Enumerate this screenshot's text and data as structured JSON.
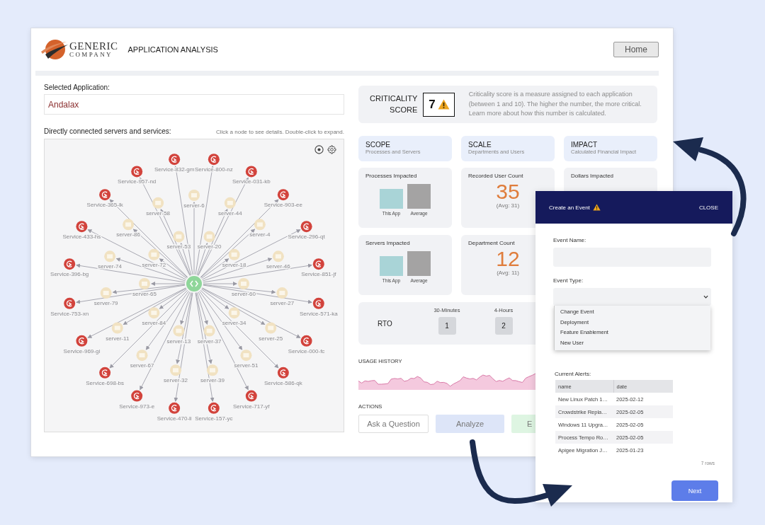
{
  "header": {
    "logo_line_1": "GENERIC",
    "logo_line_2": "COMPANY",
    "title": "APPLICATION ANALYSIS",
    "home_button": "Home"
  },
  "app_selector": {
    "label": "Selected Application:",
    "value": "Andalax"
  },
  "graph": {
    "title": "Directly connected servers and services:",
    "hint": "Click a node to see details. Double-click to expand.",
    "nodes": [
      {
        "label": "Service-832-gm",
        "kind": "service"
      },
      {
        "label": "Service-800-nz",
        "kind": "service"
      },
      {
        "label": "Service-957-nd",
        "kind": "service"
      },
      {
        "label": "Service-031-kb",
        "kind": "service"
      },
      {
        "label": "Service-365-lk",
        "kind": "service"
      },
      {
        "label": "server-6",
        "kind": "server"
      },
      {
        "label": "Service-903-ee",
        "kind": "service"
      },
      {
        "label": "server-58",
        "kind": "server"
      },
      {
        "label": "server-44",
        "kind": "server"
      },
      {
        "label": "Service-433-hs",
        "kind": "service"
      },
      {
        "label": "server-86",
        "kind": "server"
      },
      {
        "label": "server-4",
        "kind": "server"
      },
      {
        "label": "Service-296-qt",
        "kind": "service"
      },
      {
        "label": "server-53",
        "kind": "server"
      },
      {
        "label": "server-20",
        "kind": "server"
      },
      {
        "label": "server-74",
        "kind": "server"
      },
      {
        "label": "server-72",
        "kind": "server"
      },
      {
        "label": "server-18",
        "kind": "server"
      },
      {
        "label": "server-46",
        "kind": "server"
      },
      {
        "label": "Service-396-bg",
        "kind": "service"
      },
      {
        "label": "Service-851-jf",
        "kind": "service"
      },
      {
        "label": "server-65",
        "kind": "server"
      },
      {
        "label": "server-60",
        "kind": "server"
      },
      {
        "label": "server-79",
        "kind": "server"
      },
      {
        "label": "server-27",
        "kind": "server"
      },
      {
        "label": "Service-753-xn",
        "kind": "service"
      },
      {
        "label": "Service-571-ka",
        "kind": "service"
      },
      {
        "label": "server-84",
        "kind": "server"
      },
      {
        "label": "server-34",
        "kind": "server"
      },
      {
        "label": "server-11",
        "kind": "server"
      },
      {
        "label": "server-13",
        "kind": "server"
      },
      {
        "label": "server-37",
        "kind": "server"
      },
      {
        "label": "server-25",
        "kind": "server"
      },
      {
        "label": "Service-969-gi",
        "kind": "service"
      },
      {
        "label": "Service-000-fc",
        "kind": "service"
      },
      {
        "label": "server-67",
        "kind": "server"
      },
      {
        "label": "server-51",
        "kind": "server"
      },
      {
        "label": "Service-698-bs",
        "kind": "service"
      },
      {
        "label": "server-32",
        "kind": "server"
      },
      {
        "label": "server-39",
        "kind": "server"
      },
      {
        "label": "Service-586-qk",
        "kind": "service"
      },
      {
        "label": "Service-973-e",
        "kind": "service"
      },
      {
        "label": "Service-717-yf",
        "kind": "service"
      },
      {
        "label": "Service-470-li",
        "kind": "service"
      },
      {
        "label": "Service-157-yc",
        "kind": "service"
      }
    ]
  },
  "criticality": {
    "label_line_1": "CRITICALITY",
    "label_line_2": "SCORE",
    "score": "7",
    "description": "Criticality score is a measure assigned to each application (between 1 and 10). The higher the number, the more critical. Learn more about how this number is calculated."
  },
  "sections": [
    {
      "title": "SCOPE",
      "subtitle": "Processes and Servers"
    },
    {
      "title": "SCALE",
      "subtitle": "Departments and Users"
    },
    {
      "title": "IMPACT",
      "subtitle": "Calculated Financial Impact"
    }
  ],
  "metrics": [
    {
      "kind": "bars",
      "title": "Processes Impacted",
      "captions": [
        "This App",
        "Average"
      ]
    },
    {
      "kind": "count",
      "title": "Recorded User Count",
      "value": "35",
      "average": "(Avg: 31)"
    },
    {
      "kind": "label",
      "title": "Dollars Impacted"
    },
    {
      "kind": "bars",
      "title": "Servers Impacted",
      "captions": [
        "This App",
        "Average"
      ]
    },
    {
      "kind": "count",
      "title": "Department Count",
      "value": "12",
      "average": "(Avg: 11)"
    }
  ],
  "rto": {
    "label": "RTO",
    "tiers": [
      {
        "name": "30-Minutes",
        "value": "1"
      },
      {
        "name": "4-Hours",
        "value": "2"
      }
    ]
  },
  "usage_history": {
    "title": "USAGE HISTORY"
  },
  "actions": {
    "title": "ACTIONS",
    "buttons": [
      {
        "label": "Ask a Question",
        "kind": "outline"
      },
      {
        "label": "Analyze",
        "kind": "blue"
      },
      {
        "label": "E",
        "kind": "green"
      }
    ]
  },
  "dialog": {
    "title": "Create an Event",
    "close": "CLOSE",
    "event_name_label": "Event Name:",
    "event_type_label": "Event Type:",
    "event_type_options": [
      "Change Event",
      "Deployment",
      "Feature Enablement",
      "New User"
    ],
    "alerts_label": "Current Alerts:",
    "alerts_columns": [
      "name",
      "date"
    ],
    "alerts_rows": [
      [
        "New Linux Patch 1…",
        "2025-02-12"
      ],
      [
        "Crowdstrike Repla…",
        "2025-02-05"
      ],
      [
        "Windows 11 Upgra…",
        "2025-02-05"
      ],
      [
        "Process Tempo Ro…",
        "2025-02-05"
      ],
      [
        "Apigee Migration J…",
        "2025-01-23"
      ]
    ],
    "row_count": "7 rows",
    "next_button": "Next"
  }
}
